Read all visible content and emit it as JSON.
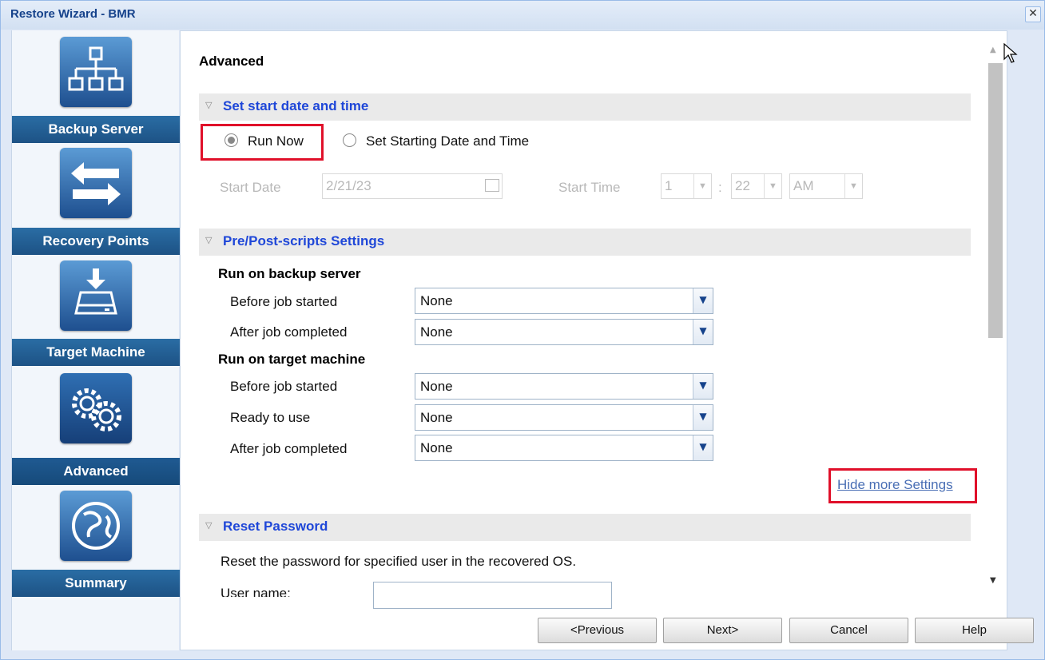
{
  "window": {
    "title": "Restore Wizard - BMR",
    "close_glyph": "✕"
  },
  "sidebar": {
    "items": [
      {
        "label": "Backup Server",
        "icon": "network-icon"
      },
      {
        "label": "Recovery Points",
        "icon": "swap-arrows-icon"
      },
      {
        "label": "Target Machine",
        "icon": "drive-download-icon"
      },
      {
        "label": "Advanced",
        "icon": "gears-icon",
        "active": true
      },
      {
        "label": "Summary",
        "icon": "globe-icon"
      }
    ]
  },
  "main": {
    "page_title": "Advanced",
    "schedule": {
      "heading": "Set start date and time",
      "run_now_label": "Run Now",
      "set_start_label": "Set Starting Date and Time",
      "selected": "Run Now",
      "start_date_label": "Start Date",
      "start_date_value": "2/21/23",
      "start_time_label": "Start Time",
      "hour": "1",
      "minute": "22",
      "ampm": "AM",
      "time_separator": ":"
    },
    "scripts": {
      "heading": "Pre/Post-scripts Settings",
      "backup_server_heading": "Run on backup server",
      "target_machine_heading": "Run on target machine",
      "rows": [
        {
          "label": "Before job started",
          "value": "None"
        },
        {
          "label": "After job completed",
          "value": "None"
        },
        {
          "label": "Before job started",
          "value": "None"
        },
        {
          "label": "Ready to use",
          "value": "None"
        },
        {
          "label": "After job completed",
          "value": "None"
        }
      ],
      "hide_link": "Hide more Settings"
    },
    "reset_password": {
      "heading": "Reset Password",
      "description": "Reset the password for specified user in the recovered OS.",
      "user_name_label": "User name:"
    }
  },
  "footer": {
    "previous": "<Previous",
    "next": "Next>",
    "cancel": "Cancel",
    "help": "Help"
  },
  "colors": {
    "accent": "#1f47d8",
    "nav_label_bg": "#1d5285",
    "highlight": "#e0102a"
  }
}
